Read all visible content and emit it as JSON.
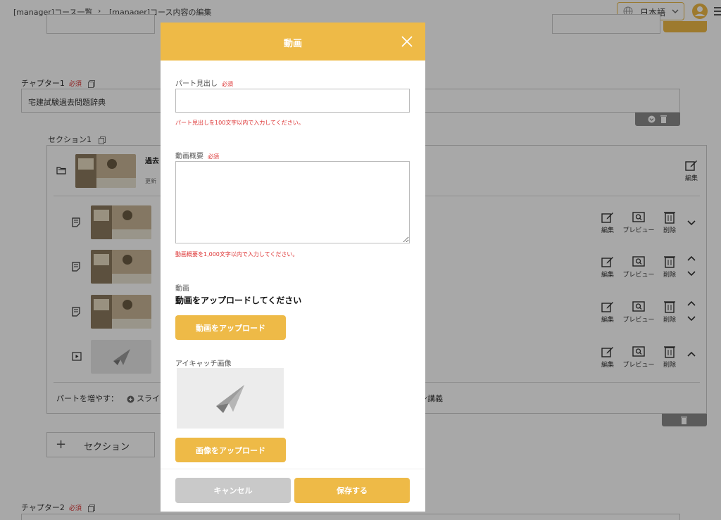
{
  "breadcrumb": [
    "[manager]コース一覧",
    "›",
    "[manager]コース内容の編集"
  ],
  "header": {
    "language": "日本語"
  },
  "background": {
    "chapter1": {
      "label": "チャプター1",
      "required": "必須",
      "value": "宅建試験過去問題辞典"
    },
    "section1": {
      "label": "セクション1",
      "title_fragment": "過去",
      "update_fragment": "更新"
    },
    "actions": {
      "edit": "編集",
      "preview": "プレビュー",
      "delete": "削除"
    },
    "add_part": {
      "label": "パートを増やす：",
      "option_fragment": "スライ",
      "tail_fragment": "ン講義"
    },
    "section_button": "セクション",
    "chapter2": {
      "label": "チャプター2",
      "required": "必須"
    }
  },
  "modal": {
    "title": "動画",
    "part_heading": {
      "label": "パート見出し",
      "required": "必須",
      "value": "",
      "placeholder": "",
      "error": "パート見出しを100文字以内で入力してください。"
    },
    "summary": {
      "label": "動画概要",
      "required": "必須",
      "value": "",
      "placeholder": "",
      "error": "動画概要を1,000文字以内で入力してください。"
    },
    "video": {
      "label": "動画",
      "prompt": "動画をアップロードしてください",
      "button": "動画をアップロード"
    },
    "eyecatch": {
      "label": "アイキャッチ画像",
      "button": "画像をアップロード"
    },
    "footer": {
      "cancel": "キャンセル",
      "save": "保存する"
    }
  },
  "colors": {
    "accent": "#eeba47",
    "required": "#dd3333",
    "cancel": "#c9c9c9"
  },
  "icons": [
    "globe-icon",
    "chevron-down-icon",
    "user-avatar-icon",
    "menu-icon",
    "close-icon",
    "copy-icon",
    "folder-icon",
    "document-icon",
    "video-icon",
    "edit-icon",
    "preview-icon",
    "trash-icon",
    "chevron-up-icon",
    "plus-icon",
    "paper-plane-icon"
  ]
}
